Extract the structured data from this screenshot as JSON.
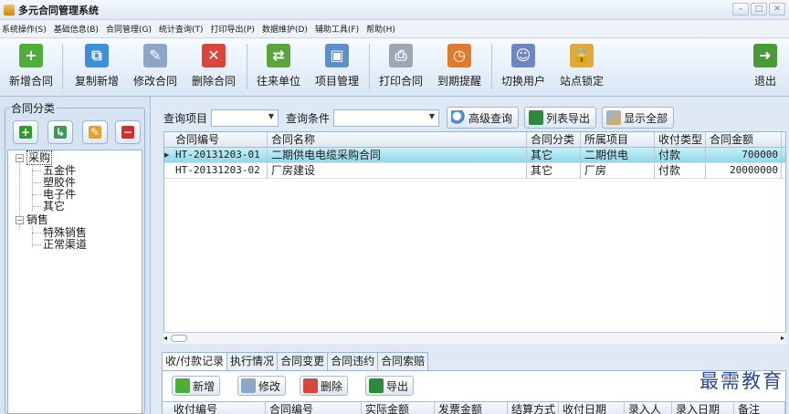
{
  "window": {
    "title": "多元合同管理系统"
  },
  "menu": [
    "系统操作(S)",
    "基础信息(B)",
    "合同管理(G)",
    "统计查询(T)",
    "打印导出(P)",
    "数据维护(D)",
    "辅助工具(F)",
    "帮助(H)"
  ],
  "toolbar": {
    "buttons": [
      {
        "label": "新增合同",
        "icon": "add-contract-icon",
        "color": "#4fae3a"
      },
      {
        "label": "复制新增",
        "icon": "copy-add-icon",
        "color": "#3d8fd8"
      },
      {
        "label": "修改合同",
        "icon": "edit-contract-icon",
        "color": "#8ca6c7"
      },
      {
        "label": "删除合同",
        "icon": "delete-contract-icon",
        "color": "#d8463c"
      },
      {
        "label": "往来单位",
        "icon": "partners-icon",
        "color": "#5aa53c"
      },
      {
        "label": "项目管理",
        "icon": "project-icon",
        "color": "#5f8fc9"
      },
      {
        "label": "打印合同",
        "icon": "printer-icon",
        "color": "#9aa7b7"
      },
      {
        "label": "到期提醒",
        "icon": "reminder-icon",
        "color": "#e07a2e"
      },
      {
        "label": "切换用户",
        "icon": "switch-user-icon",
        "color": "#6e87c3"
      },
      {
        "label": "站点锁定",
        "icon": "lock-icon",
        "color": "#e0a93b"
      }
    ],
    "exit_label": "退出"
  },
  "left_panel": {
    "title": "合同分类",
    "buttons": [
      {
        "name": "add-category-button",
        "icon": "plus-icon",
        "glyph": "+",
        "color": "#2f9a2f"
      },
      {
        "name": "sub-category-button",
        "icon": "insert-child-icon",
        "glyph": "↳",
        "color": "#3f9a5a"
      },
      {
        "name": "edit-category-button",
        "icon": "pencil-icon",
        "glyph": "✎",
        "color": "#e2a32a"
      },
      {
        "name": "delete-category-button",
        "icon": "minus-icon",
        "glyph": "−",
        "color": "#d22e2e"
      }
    ],
    "tree": {
      "group1": {
        "label": "采购",
        "children": [
          "五金件",
          "塑胶件",
          "电子件",
          "其它"
        ]
      },
      "group2": {
        "label": "销售",
        "children": [
          "特殊销售",
          "正常渠道"
        ]
      }
    }
  },
  "query": {
    "item_label": "查询项目",
    "condition_label": "查询条件",
    "advanced_label": "高级查询",
    "export_label": "列表导出",
    "show_all_label": "显示全部"
  },
  "grid": {
    "columns": [
      "合同编号",
      "合同名称",
      "合同分类",
      "所属项目",
      "收付类型",
      "合同金额"
    ],
    "rows": [
      {
        "id": "HT-20131203-01",
        "name": "二期供电电缆采购合同",
        "category": "其它",
        "project": "二期供电",
        "type": "付款",
        "amount": "700000"
      },
      {
        "id": "HT-20131203-02",
        "name": "厂房建设",
        "category": "其它",
        "project": "厂房",
        "type": "付款",
        "amount": "20000000"
      }
    ]
  },
  "tabs": [
    "收/付款记录",
    "执行情况",
    "合同变更",
    "合同违约",
    "合同索赔"
  ],
  "subtoolbar": {
    "add": "新增",
    "edit": "修改",
    "delete": "删除",
    "export": "导出"
  },
  "subgrid": {
    "columns": [
      "收付编号",
      "合同编号",
      "实际金额",
      "发票金额",
      "结算方式",
      "收付日期",
      "录入人",
      "录入日期",
      "备注"
    ]
  },
  "watermark": "最需教育"
}
